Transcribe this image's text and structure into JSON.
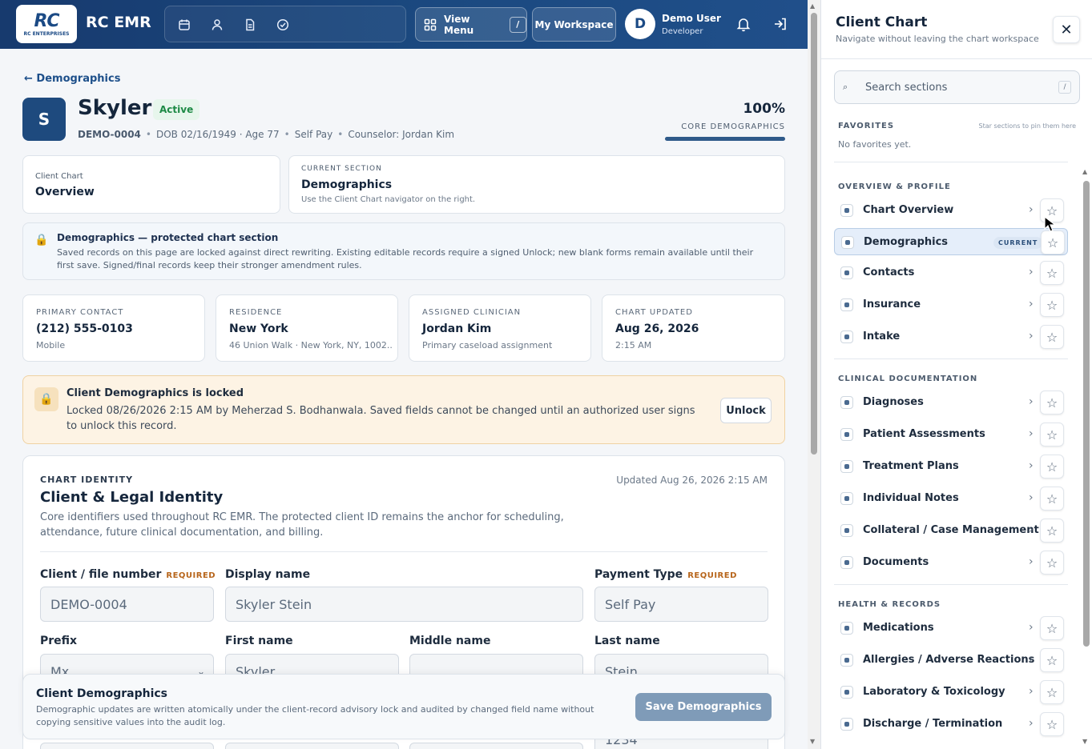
{
  "topbar": {
    "logo_text": "RC ENTERPRISES",
    "logo_mark": "RC",
    "app_name": "RC EMR",
    "quick_icons": [
      "calendar-icon",
      "person-icon",
      "document-icon",
      "check-circle-icon"
    ],
    "view_menu_label": "View Menu",
    "view_menu_shortcut": "/",
    "workspace_label": "My Workspace",
    "user_initial": "D",
    "user_name": "Demo User",
    "user_role": "Developer"
  },
  "breadcrumb": "← Demographics",
  "client": {
    "initial": "S",
    "name": "Skyler",
    "status": "Active",
    "id": "DEMO-0004",
    "dob": "DOB 02/16/1949 · Age 77",
    "payer": "Self Pay",
    "counselor": "Counselor: Jordan Kim",
    "completion": "100%",
    "completion_fraction": 1.0,
    "completion_label": "CORE DEMOGRAPHICS"
  },
  "overview_card": {
    "small": "Client Chart",
    "title": "Overview"
  },
  "current_section": {
    "small": "CURRENT SECTION",
    "title": "Demographics",
    "desc": "Use the Client Chart navigator on the right."
  },
  "protected": {
    "title": "Demographics — protected chart section",
    "desc": "Saved records on this page are locked against direct rewriting. Existing editable records require a signed Unlock; new blank forms remain available until their first save. Signed/final records keep their stronger amendment rules."
  },
  "info_cards": [
    {
      "label": "PRIMARY CONTACT",
      "value": "(212) 555-0103",
      "desc": "Mobile"
    },
    {
      "label": "RESIDENCE",
      "value": "New York",
      "desc": "46 Union Walk · New York, NY, 1002..."
    },
    {
      "label": "ASSIGNED CLINICIAN",
      "value": "Jordan Kim",
      "desc": "Primary caseload assignment"
    },
    {
      "label": "CHART UPDATED",
      "value": "Aug 26, 2026",
      "desc": "2:15 AM"
    }
  ],
  "locked": {
    "title": "Client Demographics is locked",
    "desc": "Locked 08/26/2026 2:15 AM by Meherzad S. Bodhanwala. Saved fields cannot be changed until an authorized user signs to unlock this record.",
    "button": "Unlock"
  },
  "identity": {
    "small": "CHART IDENTITY",
    "title": "Client & Legal Identity",
    "desc": "Core identifiers used throughout RC EMR. The protected client ID remains the anchor for scheduling, attendance, future clinical documentation, and billing.",
    "updated": "Updated Aug 26, 2026 2:15 AM",
    "required_tag": "REQUIRED",
    "fields": {
      "file_number": {
        "label": "Client / file number",
        "value": "DEMO-0004"
      },
      "display_name": {
        "label": "Display name",
        "value": "Skyler Stein"
      },
      "payment_type": {
        "label": "Payment Type",
        "value": "Self Pay"
      },
      "prefix": {
        "label": "Prefix",
        "value": "Mx"
      },
      "first_name": {
        "label": "First name",
        "value": "Skyler"
      },
      "middle_name": {
        "label": "Middle name",
        "value": ""
      },
      "last_name": {
        "label": "Last name",
        "value": "Stein"
      },
      "partial_value": "1234"
    }
  },
  "savebar": {
    "title": "Client Demographics",
    "desc": "Demographic updates are written atomically under the client-record advisory lock and audited by changed field name without copying sensitive values into the audit log.",
    "button": "Save Demographics"
  },
  "panel": {
    "title": "Client Chart",
    "subtitle": "Navigate without leaving the chart workspace",
    "close": "✕",
    "search_placeholder": "Search sections",
    "search_shortcut": "/",
    "favorites_heading": "FAVORITES",
    "favorites_hint": "Star sections to pin them here",
    "favorites_empty": "No favorites yet.",
    "current_tag": "CURRENT",
    "groups": [
      {
        "heading": "OVERVIEW & PROFILE",
        "items": [
          "Chart Overview",
          "Demographics",
          "Contacts",
          "Insurance",
          "Intake"
        ]
      },
      {
        "heading": "CLINICAL DOCUMENTATION",
        "items": [
          "Diagnoses",
          "Patient Assessments",
          "Treatment Plans",
          "Individual Notes",
          "Collateral / Case Management",
          "Documents"
        ]
      },
      {
        "heading": "HEALTH & RECORDS",
        "items": [
          "Medications",
          "Allergies / Adverse Reactions",
          "Laboratory & Toxicology",
          "Discharge / Termination"
        ]
      }
    ]
  },
  "colors": {
    "topbar": "#1b4980",
    "accent": "#1e4a7e",
    "active_green": "#1d8a45",
    "locked_bg": "#fdf3e4",
    "required": "#b7651b"
  }
}
